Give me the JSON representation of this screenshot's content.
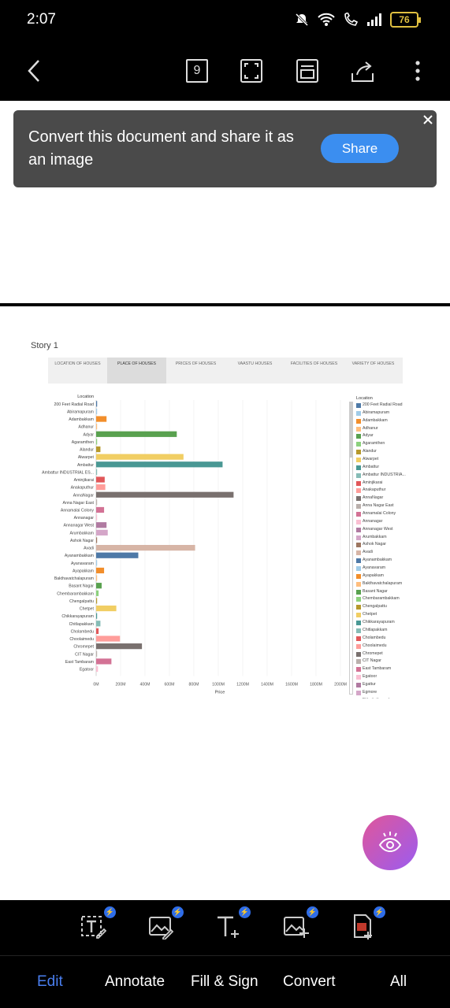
{
  "status_bar": {
    "time": "2:07",
    "battery": "76"
  },
  "toolbar": {
    "page_count": "9",
    "icons": [
      "back-icon",
      "pages-icon",
      "fullscreen-icon",
      "reader-view-icon",
      "share-icon",
      "more-icon"
    ]
  },
  "toast": {
    "message": "Convert this document and share it as an image",
    "share_label": "Share"
  },
  "document": {
    "story_title": "Story 1",
    "tabs": [
      "LOCATION OF HOUSES",
      "PLACE OF HOUSES",
      "PRICES OF HOUSES",
      "VAASTU HOUSES",
      "FACILITIES OF HOUSES",
      "VARIETY OF HOUSES"
    ],
    "active_tab": "PLACE OF HOUSES",
    "legend_title": "Location",
    "legend": [
      {
        "name": "200 Feet Radial Road",
        "color": "#4e79a7"
      },
      {
        "name": "Abiramapuram",
        "color": "#a0cbe8"
      },
      {
        "name": "Adambakkam",
        "color": "#f28e2b"
      },
      {
        "name": "Adhanur",
        "color": "#ffbe7d"
      },
      {
        "name": "Adyar",
        "color": "#59a14f"
      },
      {
        "name": "Agaramthen",
        "color": "#8cd17d"
      },
      {
        "name": "Alandur",
        "color": "#b6992d"
      },
      {
        "name": "Alwarpet",
        "color": "#f1ce63"
      },
      {
        "name": "Ambattur",
        "color": "#499894"
      },
      {
        "name": "Ambattur INDUSTRIA...",
        "color": "#86bcb6"
      },
      {
        "name": "Aminjikarai",
        "color": "#e15759"
      },
      {
        "name": "Anakaputhur",
        "color": "#ff9d9a"
      },
      {
        "name": "AnnaNagar",
        "color": "#79706e"
      },
      {
        "name": "Anna Nagar East",
        "color": "#bab0ac"
      },
      {
        "name": "Annamalai Colony",
        "color": "#d37295"
      },
      {
        "name": "Annanagar",
        "color": "#fabfd2"
      },
      {
        "name": "Annanagar West",
        "color": "#b07aa1"
      },
      {
        "name": "Arumbakkam",
        "color": "#d4a6c8"
      },
      {
        "name": "Ashok Nagar",
        "color": "#9d7660"
      },
      {
        "name": "Avadi",
        "color": "#d7b5a6"
      },
      {
        "name": "Ayanambakkam",
        "color": "#4e79a7"
      },
      {
        "name": "Ayanavaram",
        "color": "#a0cbe8"
      },
      {
        "name": "Ayapakkam",
        "color": "#f28e2b"
      },
      {
        "name": "Bakthavatchalapuram",
        "color": "#ffbe7d"
      },
      {
        "name": "Basant Nagar",
        "color": "#59a14f"
      },
      {
        "name": "Chembarambakkam",
        "color": "#8cd17d"
      },
      {
        "name": "Chengalpattu",
        "color": "#b6992d"
      },
      {
        "name": "Chetpet",
        "color": "#f1ce63"
      },
      {
        "name": "Chikkarayapuram",
        "color": "#499894"
      },
      {
        "name": "Chitlapakkam",
        "color": "#86bcb6"
      },
      {
        "name": "Cholambedu",
        "color": "#e15759"
      },
      {
        "name": "Choolaimedu",
        "color": "#ff9d9a"
      },
      {
        "name": "Chromepet",
        "color": "#79706e"
      },
      {
        "name": "CIT Nagar",
        "color": "#bab0ac"
      },
      {
        "name": "East Tambaram",
        "color": "#d37295"
      },
      {
        "name": "Egatoor",
        "color": "#fabfd2"
      },
      {
        "name": "Egattur",
        "color": "#b07aa1"
      },
      {
        "name": "Egmore",
        "color": "#d4a6c8"
      },
      {
        "name": "Ekkattuthangal",
        "color": "#9d7660"
      }
    ]
  },
  "chart_data": {
    "type": "bar",
    "orientation": "horizontal",
    "category_axis_title": "Location",
    "xlabel": "Price",
    "xlim": [
      0,
      2000
    ],
    "x_unit": "M",
    "x_ticks": [
      "0M",
      "200M",
      "400M",
      "600M",
      "800M",
      "1000M",
      "1200M",
      "1400M",
      "1600M",
      "1800M",
      "2000M"
    ],
    "categories": [
      "200 Feet Radial Road",
      "Abiramapuram",
      "Adambakkam",
      "Adhanur",
      "Adyar",
      "Agaramthen",
      "Alandur",
      "Alwarpet",
      "Ambattur",
      "Ambattur INDUSTRIAL ES...",
      "Aminjikarai",
      "Anakaputhur",
      "AnnaNagar",
      "Anna Nagar East",
      "Annamalai Colony",
      "Annanagar",
      "Annanagar West",
      "Arumbakkam",
      "Ashok Nagar",
      "Avadi",
      "Ayanambakkam",
      "Ayanavaram",
      "Ayapakkam",
      "Bakthavatchalapuram",
      "Basant Nagar",
      "Chembarambakkam",
      "Chengalpattu",
      "Chetpet",
      "Chikkarayapuram",
      "Chitlapakkam",
      "Cholambedu",
      "Choolaimedu",
      "Chromepet",
      "CIT Nagar",
      "East Tambaram",
      "Egatoor"
    ],
    "values": [
      8,
      3,
      85,
      3,
      660,
      8,
      35,
      715,
      1035,
      5,
      70,
      75,
      1125,
      5,
      65,
      5,
      85,
      95,
      5,
      810,
      345,
      5,
      65,
      5,
      45,
      20,
      5,
      165,
      5,
      35,
      20,
      195,
      375,
      3,
      125,
      15
    ],
    "colors": [
      "#4e79a7",
      "#a0cbe8",
      "#f28e2b",
      "#ffbe7d",
      "#59a14f",
      "#8cd17d",
      "#b6992d",
      "#f1ce63",
      "#499894",
      "#86bcb6",
      "#e15759",
      "#ff9d9a",
      "#79706e",
      "#bab0ac",
      "#d37295",
      "#fabfd2",
      "#b07aa1",
      "#d4a6c8",
      "#9d7660",
      "#d7b5a6",
      "#4e79a7",
      "#a0cbe8",
      "#f28e2b",
      "#ffbe7d",
      "#59a14f",
      "#8cd17d",
      "#b6992d",
      "#f1ce63",
      "#499894",
      "#86bcb6",
      "#e15759",
      "#ff9d9a",
      "#79706e",
      "#bab0ac",
      "#d37295",
      "#fabfd2"
    ],
    "grid": true
  },
  "bottom_tools": [
    "edit-text-icon",
    "edit-image-icon",
    "add-text-icon",
    "add-image-icon",
    "pdf-convert-icon"
  ],
  "bottom_nav": {
    "items": [
      "Edit",
      "Annotate",
      "Fill & Sign",
      "Convert",
      "All"
    ],
    "active": "Edit"
  }
}
